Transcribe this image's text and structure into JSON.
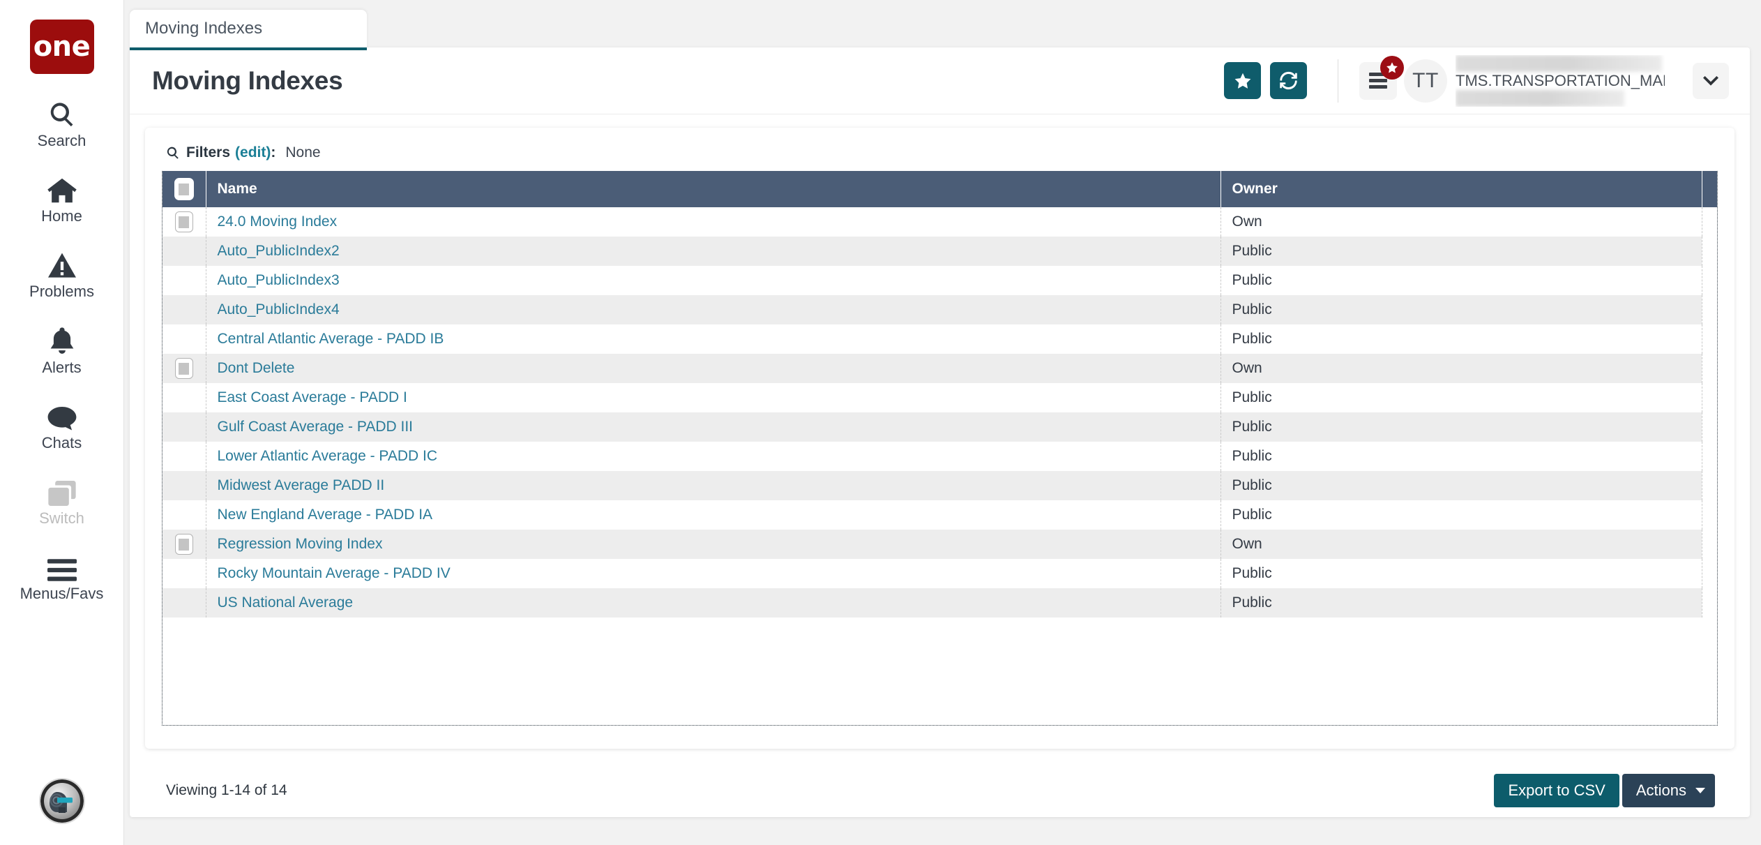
{
  "brand": {
    "logo_text": "one",
    "logo_color": "#9c0d0d"
  },
  "sidebar": {
    "items": [
      {
        "label": "Search",
        "icon": "search-icon",
        "disabled": false
      },
      {
        "label": "Home",
        "icon": "home-icon",
        "disabled": false
      },
      {
        "label": "Problems",
        "icon": "warning-icon",
        "disabled": false
      },
      {
        "label": "Alerts",
        "icon": "bell-icon",
        "disabled": false
      },
      {
        "label": "Chats",
        "icon": "chat-icon",
        "disabled": false
      },
      {
        "label": "Switch",
        "icon": "switch-icon",
        "disabled": true
      },
      {
        "label": "Menus/Favs",
        "icon": "hamburger-icon",
        "disabled": false
      }
    ],
    "bottom_avatar": "robot-assistant-avatar"
  },
  "tabs": [
    {
      "label": "Moving Indexes",
      "active": true
    }
  ],
  "header": {
    "title": "Moving Indexes",
    "favorite_icon": "star-icon",
    "refresh_icon": "refresh-icon",
    "menu_icon": "list-menu-icon",
    "menu_badge_icon": "star-badge-icon",
    "avatar_initials": "TT",
    "user_name": "TMS.TRANSPORTATION_MANAGER",
    "chevron_icon": "chevron-down-icon",
    "accent_color": "#0f5c6b",
    "badge_color": "#9c0d14"
  },
  "filters": {
    "icon": "search-icon",
    "label": "Filters",
    "edit_label": "(edit)",
    "colon": ":",
    "value": "None"
  },
  "table": {
    "columns": [
      "Name",
      "Owner"
    ],
    "select_all_checkbox": true,
    "rows": [
      {
        "name": "24.0 Moving Index",
        "owner": "Own",
        "checkbox": true
      },
      {
        "name": "Auto_PublicIndex2",
        "owner": "Public",
        "checkbox": false
      },
      {
        "name": "Auto_PublicIndex3",
        "owner": "Public",
        "checkbox": false
      },
      {
        "name": "Auto_PublicIndex4",
        "owner": "Public",
        "checkbox": false
      },
      {
        "name": "Central Atlantic Average - PADD IB",
        "owner": "Public",
        "checkbox": false
      },
      {
        "name": "Dont Delete",
        "owner": "Own",
        "checkbox": true
      },
      {
        "name": "East Coast Average - PADD I",
        "owner": "Public",
        "checkbox": false
      },
      {
        "name": "Gulf Coast Average - PADD III",
        "owner": "Public",
        "checkbox": false
      },
      {
        "name": "Lower Atlantic Average - PADD IC",
        "owner": "Public",
        "checkbox": false
      },
      {
        "name": "Midwest Average PADD II",
        "owner": "Public",
        "checkbox": false
      },
      {
        "name": "New England Average - PADD IA",
        "owner": "Public",
        "checkbox": false
      },
      {
        "name": "Regression Moving Index",
        "owner": "Own",
        "checkbox": true
      },
      {
        "name": "Rocky Mountain Average - PADD IV",
        "owner": "Public",
        "checkbox": false
      },
      {
        "name": "US National Average",
        "owner": "Public",
        "checkbox": false
      }
    ]
  },
  "footer": {
    "viewing_text": "Viewing 1-14 of 14",
    "export_label": "Export to CSV",
    "actions_label": "Actions",
    "export_color": "#0d5c6b",
    "actions_color": "#2b4257"
  }
}
